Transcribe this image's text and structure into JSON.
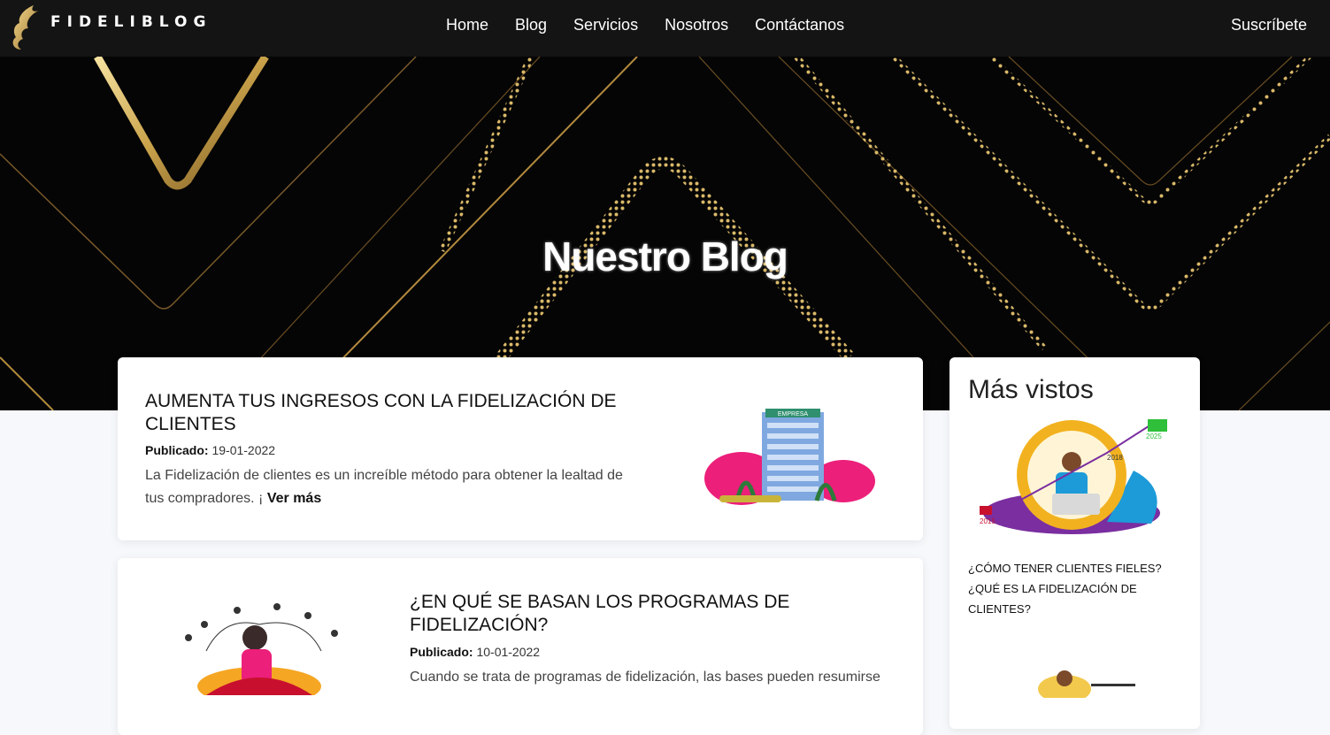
{
  "brand": {
    "name": "FIDELIBLOG"
  },
  "nav": {
    "links": [
      "Home",
      "Blog",
      "Servicios",
      "Nosotros",
      "Contáctanos"
    ],
    "subscribe": "Suscríbete"
  },
  "hero": {
    "title": "Nuestro Blog"
  },
  "posts": [
    {
      "title": "AUMENTA TUS INGRESOS CON LA FIDELIZACIÓN DE CLIENTES",
      "published_label": "Publicado:",
      "date": "19-01-2022",
      "excerpt": "La Fidelización de clientes es un increíble método para obtener la lealtad de tus compradores. ¡",
      "read_more": "Ver más",
      "image_label": "EMPRESA"
    },
    {
      "title": "¿EN QUÉ SE BASAN LOS PROGRAMAS DE FIDELIZACIÓN?",
      "published_label": "Publicado:",
      "date": "10-01-2022",
      "excerpt": "Cuando se trata de programas de fidelización, las bases pueden resumirse"
    }
  ],
  "sidebar": {
    "title": "Más vistos",
    "items": [
      {
        "title": "¿CÓMO TENER CLIENTES FIELES? ¿QUÉ ES LA FIDELIZACIÓN DE CLIENTES?",
        "image_years": [
          "2015",
          "2018",
          "2025"
        ]
      }
    ]
  },
  "colors": {
    "gold": "#c9a24a",
    "nav_bg": "#141414",
    "page_bg": "#f6f8fb"
  }
}
